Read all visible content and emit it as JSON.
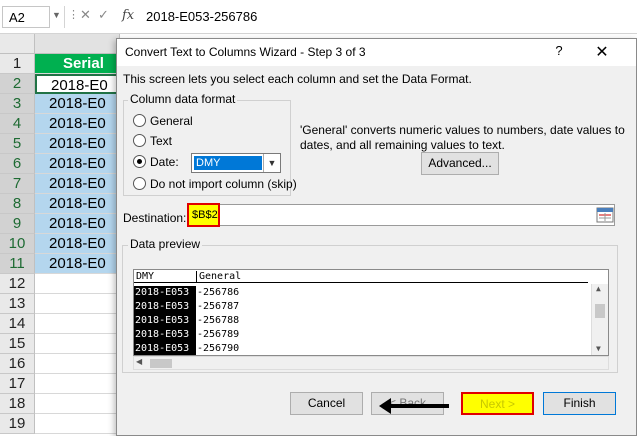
{
  "excel": {
    "name_box": "A2",
    "fx_label": "fx",
    "formula_bar_value": "2018-E053-256786",
    "header_cell": "Serial",
    "rows": [
      "1",
      "2",
      "3",
      "4",
      "5",
      "6",
      "7",
      "8",
      "9",
      "10",
      "11",
      "12",
      "13",
      "14",
      "15",
      "16",
      "17",
      "18",
      "19"
    ],
    "data_cells": [
      "2018-E0",
      "2018-E0",
      "2018-E0",
      "2018-E0",
      "2018-E0",
      "2018-E0",
      "2018-E0",
      "2018-E0",
      "2018-E0",
      "2018-E0"
    ]
  },
  "dialog": {
    "title": "Convert Text to Columns Wizard - Step 3 of 3",
    "help": "?",
    "close": "✕",
    "description": "This screen lets you select each column and set the Data Format.",
    "group_label": "Column data format",
    "options": {
      "general": "General",
      "text": "Text",
      "date": "Date:",
      "skip": "Do not import column (skip)"
    },
    "selected_option": "date",
    "date_format": "DMY",
    "info_text": "'General' converts numeric values to numbers, date values to dates, and all remaining values to text.",
    "advanced_button": "Advanced...",
    "destination_label": "Destination:",
    "destination_value": "$B$2",
    "preview_label": "Data preview",
    "preview": {
      "col1_header": "DMY",
      "col2_header": "General",
      "col1": [
        "2018-E053",
        "2018-E053",
        "2018-E053",
        "2018-E053",
        "2018-E053"
      ],
      "col2": [
        "-256786",
        "-256787",
        "-256788",
        "-256789",
        "-256790"
      ]
    },
    "buttons": {
      "cancel": "Cancel",
      "back": "< Back",
      "next": "Next >",
      "finish": "Finish"
    }
  },
  "colors": {
    "excel_green": "#217346",
    "header_fill": "#00b050",
    "selection_fill": "#b4d6ee",
    "highlight_red": "#e00000",
    "highlight_yellow": "#ffff00"
  }
}
